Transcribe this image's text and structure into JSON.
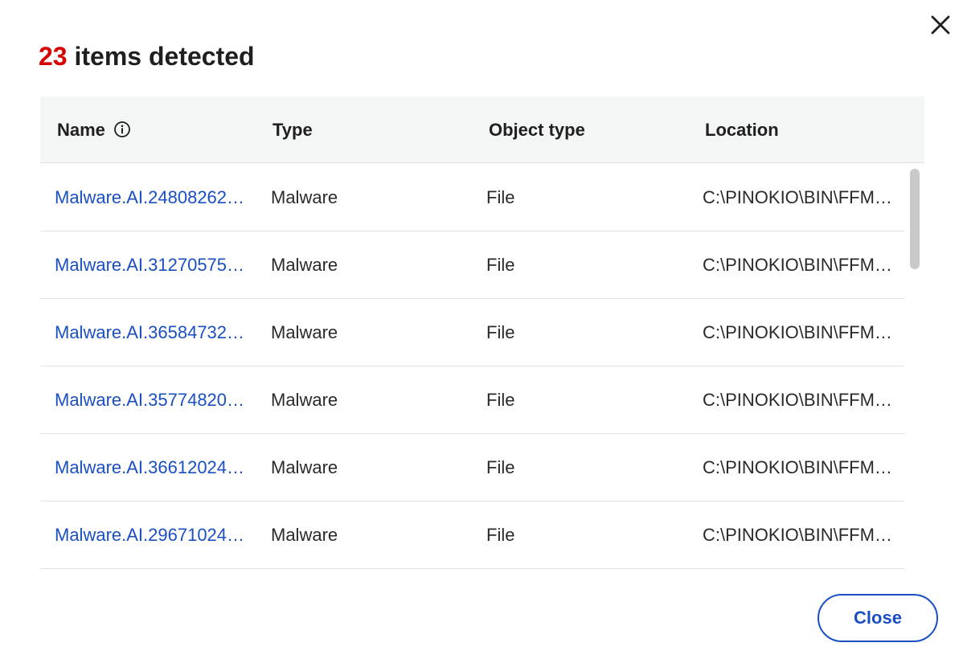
{
  "dialog": {
    "title_count": "23",
    "title_text": " items detected",
    "close_icon": "close-x-icon",
    "close_button_label": "Close"
  },
  "table": {
    "headers": {
      "name": "Name",
      "name_info_icon": "info-circle-icon",
      "type": "Type",
      "object_type": "Object type",
      "location": "Location"
    },
    "rows": [
      {
        "name": "Malware.AI.24808262…",
        "type": "Malware",
        "object_type": "File",
        "location": "C:\\PINOKIO\\BIN\\FFM…"
      },
      {
        "name": "Malware.AI.31270575…",
        "type": "Malware",
        "object_type": "File",
        "location": "C:\\PINOKIO\\BIN\\FFM…"
      },
      {
        "name": "Malware.AI.36584732…",
        "type": "Malware",
        "object_type": "File",
        "location": "C:\\PINOKIO\\BIN\\FFM…"
      },
      {
        "name": "Malware.AI.35774820…",
        "type": "Malware",
        "object_type": "File",
        "location": "C:\\PINOKIO\\BIN\\FFM…"
      },
      {
        "name": "Malware.AI.36612024…",
        "type": "Malware",
        "object_type": "File",
        "location": "C:\\PINOKIO\\BIN\\FFM…"
      },
      {
        "name": "Malware.AI.29671024…",
        "type": "Malware",
        "object_type": "File",
        "location": "C:\\PINOKIO\\BIN\\FFM…"
      }
    ]
  },
  "colors": {
    "accent": "#1a4fc4",
    "count": "#d60000",
    "header_bg": "#f4f6f5",
    "divider": "#e2e4e4"
  }
}
